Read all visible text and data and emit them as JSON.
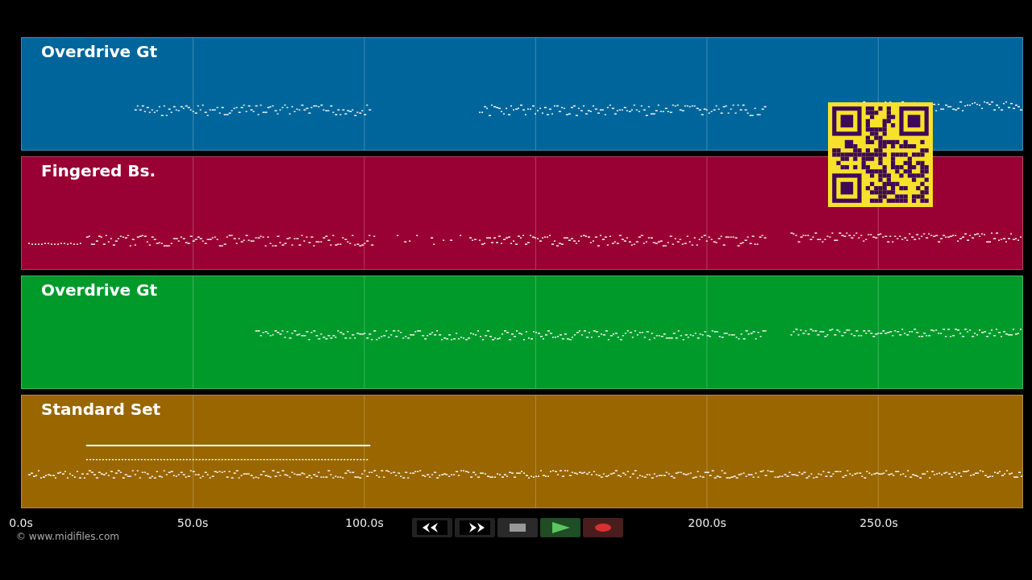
{
  "tracks": [
    {
      "name": "Overdrive Gt",
      "color": "#00659a"
    },
    {
      "name": "Fingered Bs.",
      "color": "#990033"
    },
    {
      "name": "Overdrive Gt",
      "color": "#009a2b"
    },
    {
      "name": "Standard Set",
      "color": "#996600"
    }
  ],
  "axis_labels": [
    "0.0s",
    "50.0s",
    "100.0s",
    "200.0s",
    "250.0s"
  ],
  "copyright": "© www.midifiles.com",
  "controls": [
    {
      "kind": "rewind"
    },
    {
      "kind": "forward"
    },
    {
      "kind": "stop"
    },
    {
      "kind": "play"
    },
    {
      "kind": "record"
    }
  ]
}
